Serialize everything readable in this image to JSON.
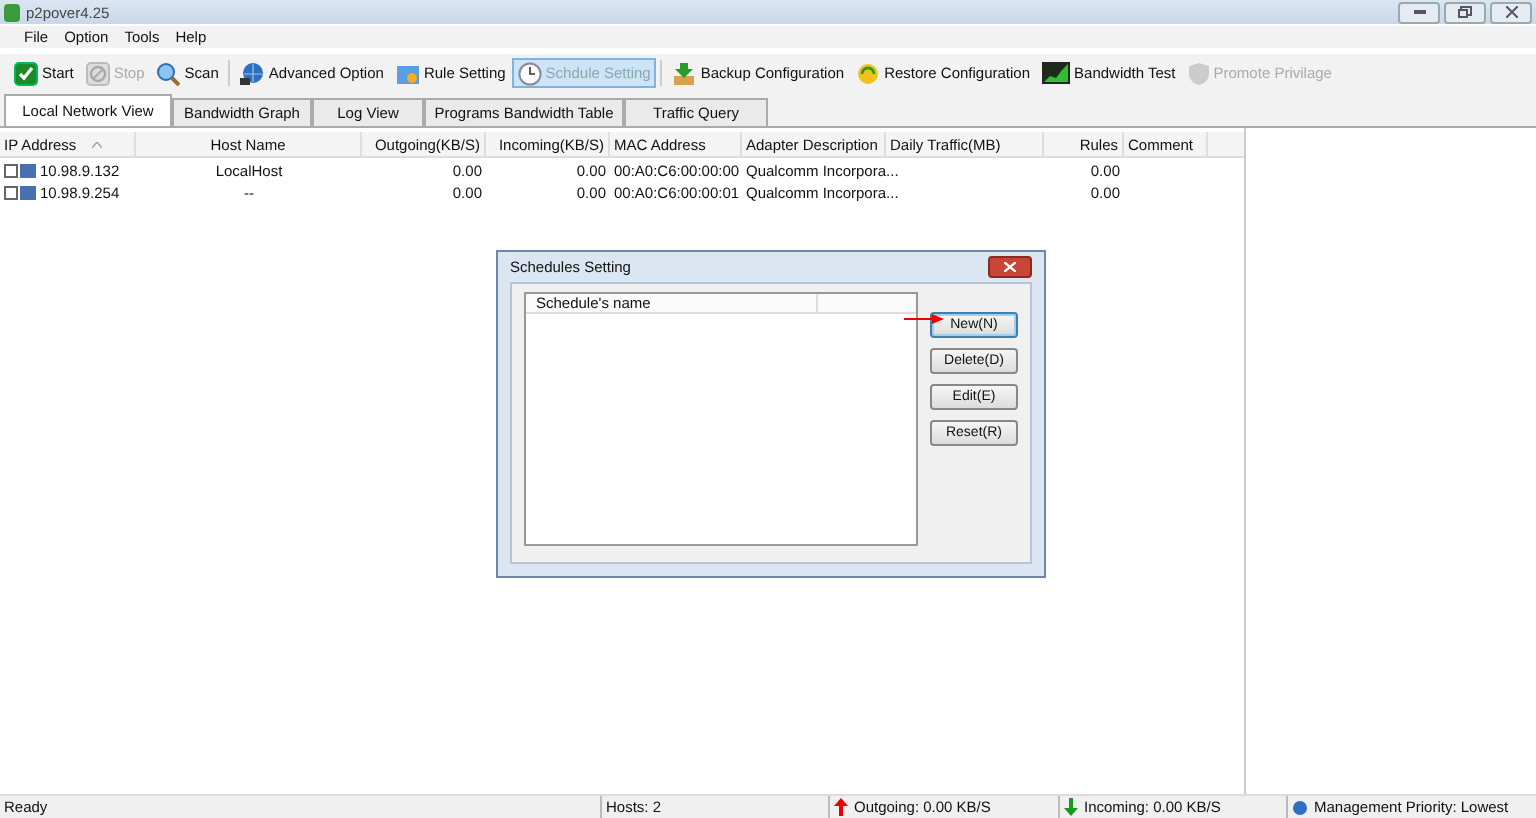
{
  "window": {
    "title": "p2pover4.25"
  },
  "menu": [
    "File",
    "Option",
    "Tools",
    "Help"
  ],
  "toolbar": [
    {
      "label": "Start",
      "disabled": false,
      "selected": false
    },
    {
      "label": "Stop",
      "disabled": true,
      "selected": false
    },
    {
      "label": "Scan",
      "disabled": false,
      "selected": false
    },
    {
      "label": "Advanced Option",
      "disabled": false,
      "selected": false
    },
    {
      "label": "Rule Setting",
      "disabled": false,
      "selected": false
    },
    {
      "label": "Schdule Setting",
      "disabled": false,
      "selected": true
    },
    {
      "label": "Backup Configuration",
      "disabled": false,
      "selected": false
    },
    {
      "label": "Restore Configuration",
      "disabled": false,
      "selected": false
    },
    {
      "label": "Bandwidth Test",
      "disabled": false,
      "selected": false
    },
    {
      "label": "Promote Privilage",
      "disabled": true,
      "selected": false
    }
  ],
  "tabs": [
    {
      "label": "Local Network View",
      "selected": true
    },
    {
      "label": "Bandwidth Graph",
      "selected": false
    },
    {
      "label": "Log View",
      "selected": false
    },
    {
      "label": "Programs Bandwidth Table",
      "selected": false
    },
    {
      "label": "Traffic Query",
      "selected": false
    }
  ],
  "table": {
    "columns": [
      "IP Address",
      "Host Name",
      "Outgoing(KB/S)",
      "Incoming(KB/S)",
      "MAC Address",
      "Adapter Description",
      "Daily Traffic(MB)",
      "Rules",
      "Comment"
    ],
    "rows": [
      {
        "checked": false,
        "cells": [
          "10.98.9.132",
          "LocalHost",
          "0.00",
          "0.00",
          "00:A0:C6:00:00:00",
          "Qualcomm Incorpora...",
          "",
          "0.00",
          ""
        ]
      },
      {
        "checked": false,
        "cells": [
          "10.98.9.254",
          "--",
          "0.00",
          "0.00",
          "00:A0:C6:00:00:01",
          "Qualcomm Incorpora...",
          "",
          "0.00",
          ""
        ]
      }
    ]
  },
  "dialog": {
    "title": "Schedules Setting",
    "list_columns": [
      "Schedule's name"
    ],
    "buttons": [
      "New(N)",
      "Delete(D)",
      "Edit(E)",
      "Reset(R)"
    ]
  },
  "status_bar": {
    "message": "Ready",
    "hosts": "Hosts: 2",
    "outgoing": "Outgoing: 0.00 KB/S",
    "incoming": "Incoming: 0.00 KB/S",
    "priority": "Management Priority: Lowest"
  }
}
